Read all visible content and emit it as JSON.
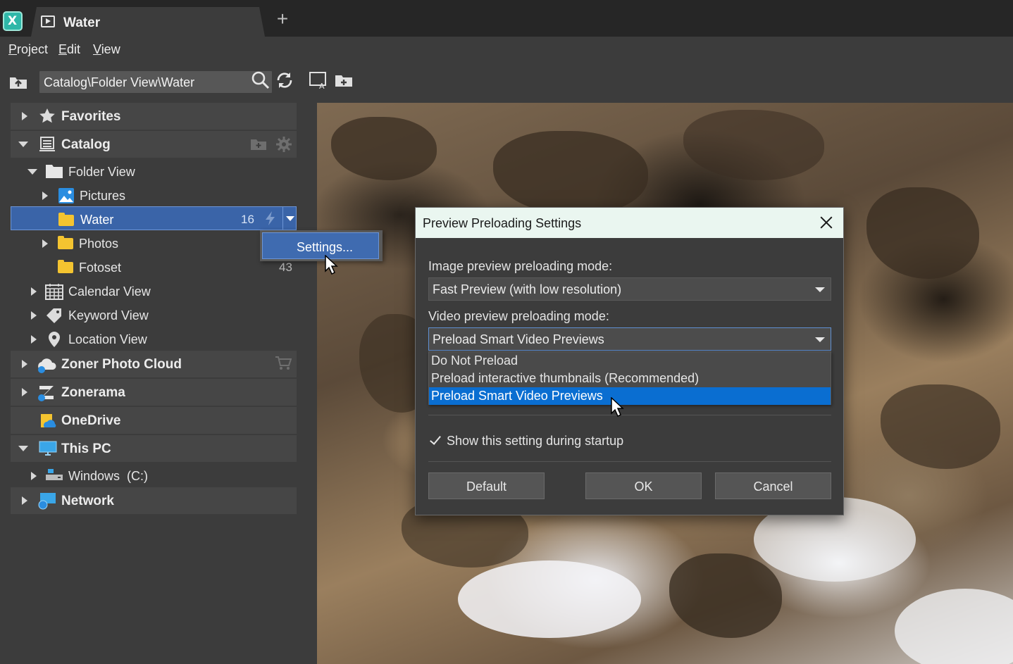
{
  "app": {
    "logo_letter": "X"
  },
  "tab": {
    "title": "Water",
    "new_tab_symbol": "+"
  },
  "menu": [
    "Project",
    "Edit",
    "View"
  ],
  "toolbar": {
    "path": "Catalog\\Folder View\\Water"
  },
  "sidebar": {
    "favorites": "Favorites",
    "catalog": "Catalog",
    "folder_view": "Folder View",
    "pictures": "Pictures",
    "water": {
      "label": "Water",
      "count": "16"
    },
    "photos": "Photos",
    "fotoset": {
      "label": "Fotoset",
      "count": "43"
    },
    "calendar_view": "Calendar View",
    "keyword_view": "Keyword View",
    "location_view": "Location View",
    "zoner_photo_cloud": "Zoner Photo Cloud",
    "zonerama": "Zonerama",
    "onedrive": "OneDrive",
    "this_pc": "This PC",
    "windows_drive": "Windows  (C:)",
    "network": "Network"
  },
  "context_menu": {
    "settings": "Settings..."
  },
  "dialog": {
    "title": "Preview Preloading Settings",
    "image_mode_label": "Image preview preloading mode:",
    "image_mode_value": "Fast Preview (with low resolution)",
    "video_mode_label": "Video preview preloading mode:",
    "video_mode_value": "Preload Smart Video Previews",
    "video_options": [
      "Do Not Preload",
      "Preload interactive thumbnails (Recommended)",
      "Preload Smart Video Previews"
    ],
    "show_at_startup": "Show this setting during startup",
    "show_at_startup_checked": true,
    "buttons": {
      "default": "Default",
      "ok": "OK",
      "cancel": "Cancel"
    }
  },
  "colors": {
    "selection_blue": "#3a64a8",
    "dropdown_highlight": "#0a6ed1",
    "folder_yellow": "#f4c430",
    "dialog_title_bg": "#eaf6f0"
  }
}
